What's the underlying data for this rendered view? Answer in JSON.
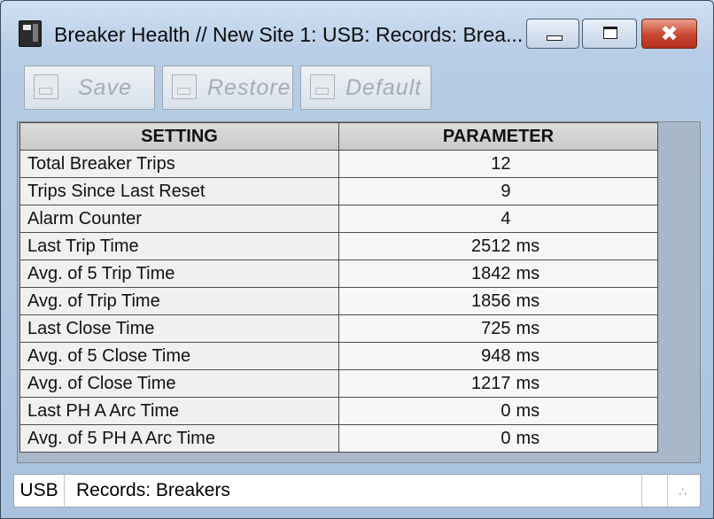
{
  "window": {
    "title": "Breaker Health // New Site 1: USB: Records: Brea...",
    "controls": {
      "minimize_icon": "minimize-icon",
      "maximize_icon": "maximize-icon",
      "close_symbol": "✖"
    }
  },
  "toolbar": {
    "save_label": "Save",
    "restore_label": "Restore",
    "default_label": "Default",
    "enabled": false
  },
  "grid": {
    "headers": [
      "SETTING",
      "PARAMETER"
    ],
    "rows": [
      {
        "setting": "Total Breaker Trips",
        "value": "12",
        "unit": ""
      },
      {
        "setting": "Trips Since Last Reset",
        "value": "9",
        "unit": ""
      },
      {
        "setting": "Alarm Counter",
        "value": "4",
        "unit": ""
      },
      {
        "setting": "Last Trip Time",
        "value": "2512",
        "unit": "ms"
      },
      {
        "setting": "Avg. of 5 Trip Time",
        "value": "1842",
        "unit": "ms"
      },
      {
        "setting": "Avg. of Trip Time",
        "value": "1856",
        "unit": "ms"
      },
      {
        "setting": "Last Close Time",
        "value": "725",
        "unit": "ms"
      },
      {
        "setting": "Avg. of 5 Close Time",
        "value": "948",
        "unit": "ms"
      },
      {
        "setting": "Avg. of Close Time",
        "value": "1217",
        "unit": "ms"
      },
      {
        "setting": "Last PH A Arc Time",
        "value": "0",
        "unit": "ms"
      },
      {
        "setting": "Avg. of 5 PH A Arc Time",
        "value": "0",
        "unit": "ms"
      }
    ]
  },
  "statusbar": {
    "connection": "USB",
    "path": "Records: Breakers"
  },
  "colors": {
    "window_frame": "#b7cde6",
    "close_button": "#c8452e",
    "grid_background": "#a8b8c9"
  }
}
